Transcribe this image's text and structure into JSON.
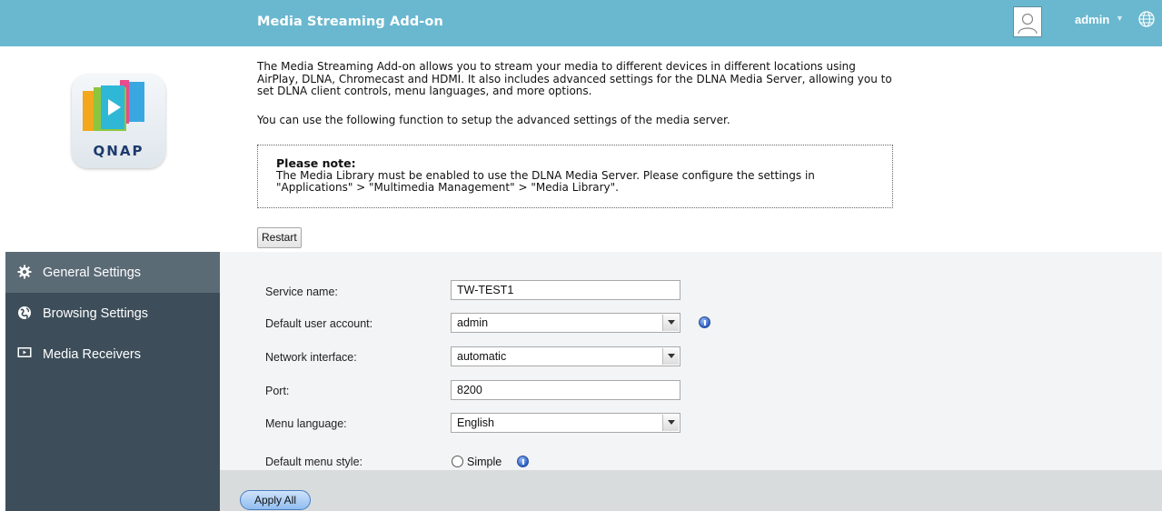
{
  "header": {
    "title": "Media Streaming Add-on",
    "user": "admin",
    "bg_color": "#6ab8cf"
  },
  "logo": {
    "text": "QNAP"
  },
  "intro": {
    "paragraph": "The Media Streaming Add-on allows you to stream your media to different devices in different locations using AirPlay, DLNA, Chromecast and HDMI. It also includes advanced settings for the DLNA Media Server, allowing you to set DLNA client controls, menu languages, and more options.",
    "setup_hint": "You can use the following function to setup the advanced settings of the media server."
  },
  "note": {
    "title": "Please note:",
    "body": "The Media Library must be enabled to use the DLNA Media Server. Please configure the settings in \"Applications\" > \"Multimedia Management\" > \"Media Library\"."
  },
  "actions": {
    "restart": "Restart",
    "apply_all": "Apply All"
  },
  "sidebar": {
    "items": [
      {
        "label": "General Settings",
        "icon": "gear-icon",
        "active": true
      },
      {
        "label": "Browsing Settings",
        "icon": "globe-icon",
        "active": false
      },
      {
        "label": "Media Receivers",
        "icon": "screen-icon",
        "active": false
      }
    ]
  },
  "form": {
    "service_name": {
      "label": "Service name:",
      "value": "TW-TEST1"
    },
    "default_user": {
      "label": "Default user account:",
      "value": "admin"
    },
    "network_interface": {
      "label": "Network interface:",
      "value": "automatic"
    },
    "port": {
      "label": "Port:",
      "value": "8200"
    },
    "menu_language": {
      "label": "Menu language:",
      "value": "English"
    },
    "menu_style": {
      "label": "Default menu style:",
      "option": "Simple"
    }
  }
}
